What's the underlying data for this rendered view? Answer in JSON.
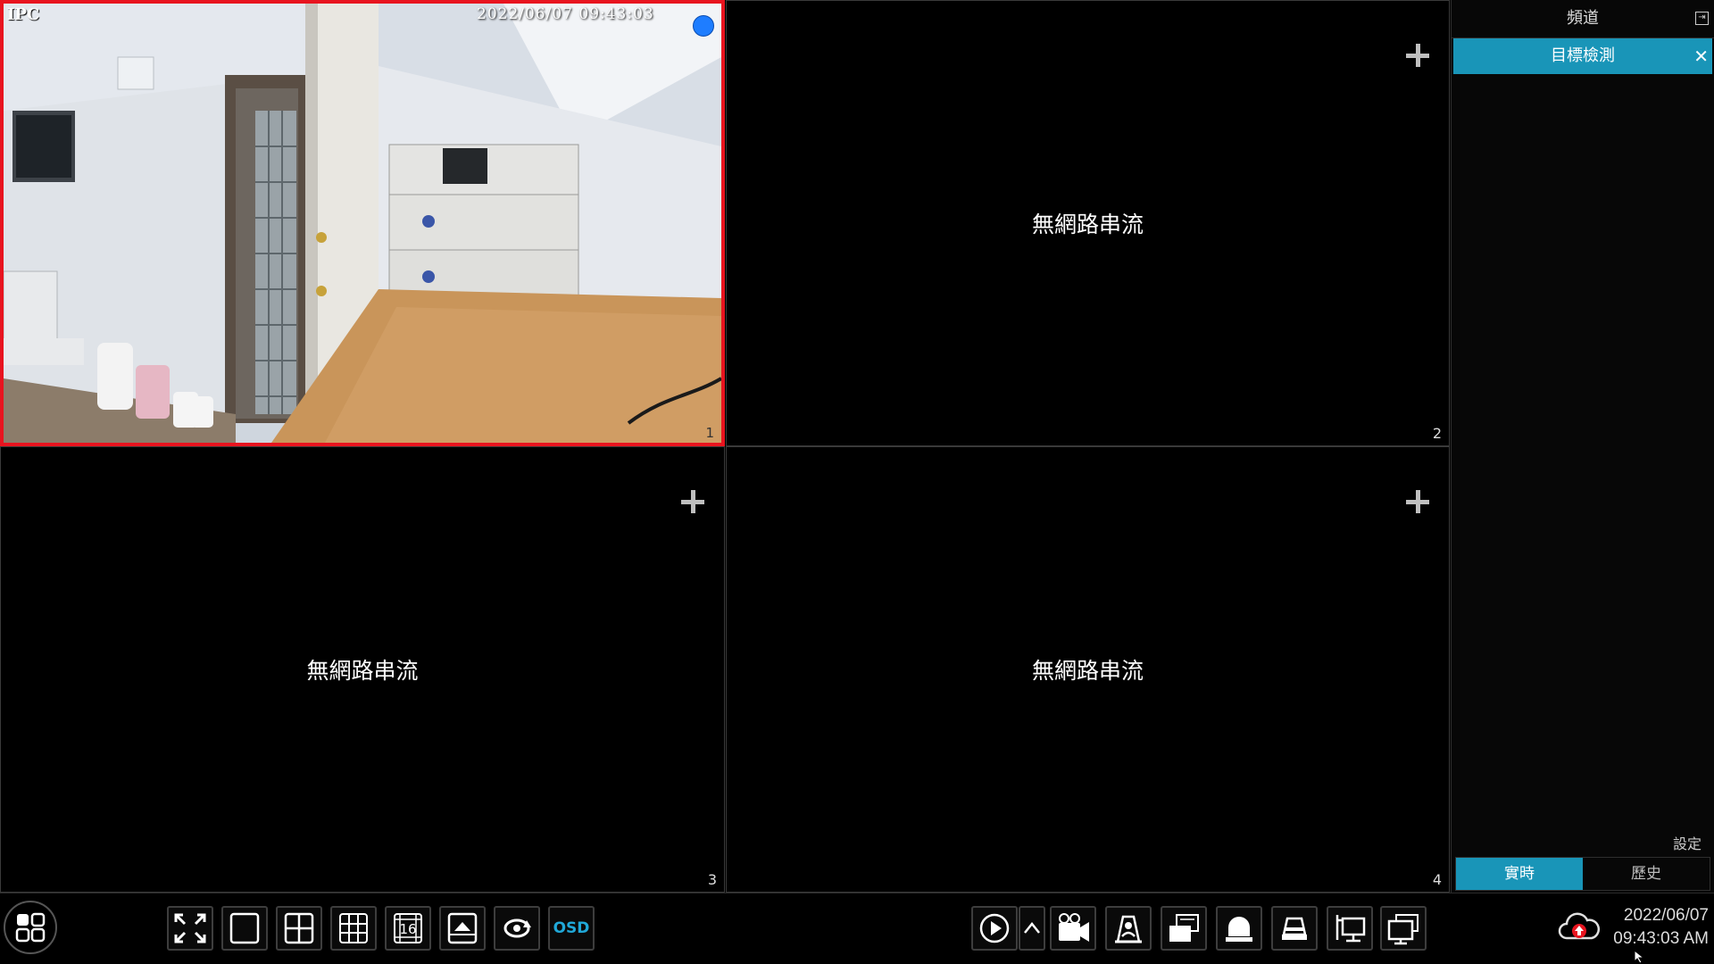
{
  "tiles": [
    {
      "number": "1",
      "camera_name": "IPC",
      "timestamp": "2022/06/07  09:43:03",
      "active": true
    },
    {
      "number": "2",
      "message": "無網路串流"
    },
    {
      "number": "3",
      "message": "無網路串流"
    },
    {
      "number": "4",
      "message": "無網路串流"
    }
  ],
  "panel": {
    "header": "頻道",
    "active_tab": "目標檢測",
    "settings_label": "設定",
    "modes": [
      "實時",
      "歷史"
    ],
    "selected_mode": "實時"
  },
  "toolbar": {
    "osd_label": "OSD",
    "layout_16_label": "16",
    "date": "2022/06/07",
    "time": "09:43:03 AM"
  },
  "colors": {
    "accent": "#1995b8",
    "active_tile_border": "#e8141f",
    "record_indicator": "#1e7dff",
    "cloud_alert": "#e8141f"
  }
}
